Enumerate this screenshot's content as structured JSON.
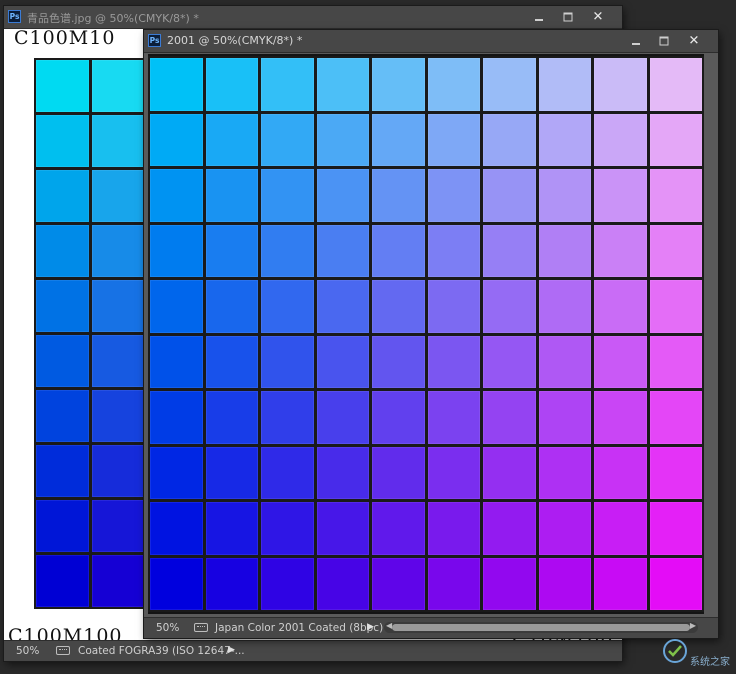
{
  "back_window": {
    "title": "青品色谱.jpg @ 50%(CMYK/8*) *",
    "label_top_left": "C100M10",
    "label_bottom_left": "C100M100",
    "label_bottom_right": "C10M100",
    "status_zoom": "50%",
    "status_profile": "Coated FOGRA39 (ISO 12647-...",
    "status_arrow": "▶"
  },
  "front_window": {
    "title": "2001 @ 50%(CMYK/8*) *",
    "status_zoom": "50%",
    "status_profile": "Japan Color 2001 Coated (8bpc)",
    "status_arrow": "▶"
  },
  "window_controls": {
    "minimize": "minimize",
    "maximize": "maximize",
    "close": "✕"
  },
  "icons": {
    "app": "photoshop-icon",
    "profile": "color-profile-icon",
    "watermark": "watermark-logo"
  },
  "colors": {
    "ui_dark": "#2a2a2a",
    "titlebar": "#474747",
    "swatch_gap": "#1a1a1a"
  },
  "watermark_text": "系统之家"
}
